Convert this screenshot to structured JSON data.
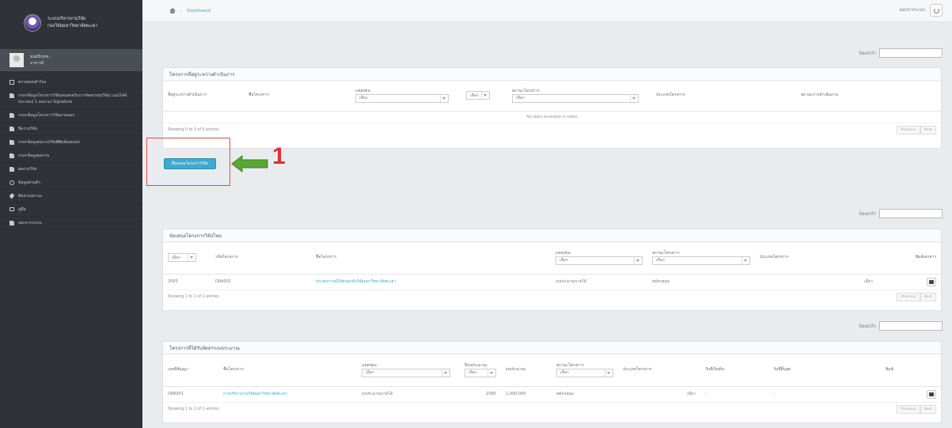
{
  "sidebar": {
    "brand_line1": "ระบบบริหารงานวิจัย",
    "brand_line2": "กองวิจัยมหาวิทยาลัยพะเยา",
    "user_name": "ชนม์นิรชช...",
    "user_role": "อาจารย์",
    "items": [
      {
        "icon": "calculator-icon",
        "label": "ตรวจสอบคำร้อง"
      },
      {
        "icon": "doc-icon",
        "label": "กรอกข้อมูลโครงการวิจัยเสนอขอรับการจัดสรรทุนวิจัย/ แนบไฟล์ประกอบ/ 1 ลงนาม/ Signature"
      },
      {
        "icon": "doc-icon",
        "label": "กรอกข้อมูลโครงการวิจัยภายนอก"
      },
      {
        "icon": "doc-icon",
        "label": "ปิดงานวิจัย"
      },
      {
        "icon": "doc-icon",
        "label": "กรอกข้อมูลผลงานวิจัยตีพิมพ์เผยแพร่"
      },
      {
        "icon": "doc-icon",
        "label": "กรอกข้อมูลผลงาน"
      },
      {
        "icon": "doc-icon",
        "label": "ผลงานวิจัย"
      },
      {
        "icon": "gear-icon",
        "label": "ข้อมูลส่วนตัว"
      },
      {
        "icon": "pin-icon",
        "label": "ติดตามสถานะ"
      },
      {
        "icon": "monitor-icon",
        "label": "คู่มือ"
      },
      {
        "icon": "doc-icon",
        "label": "ออกจากระบบ"
      }
    ]
  },
  "topbar": {
    "breadcrumb": "Dashboard",
    "right_text": "ออกจากระบบ"
  },
  "search_label": "Search:",
  "panel1": {
    "title": "โครงการที่อยู่ระหว่างดำเนินการ",
    "columns": [
      "ที่อยู่ระหว่างดำเนินการ",
      "ชื่อโครงการ",
      "แหล่งทุน",
      "",
      "สถานะโครงการ",
      "ประเภทโครงการ",
      "สถานะการดำเนินงาน"
    ],
    "empty_text": "No data available in table",
    "showing": "Showing 0 to 0 of 0 entries",
    "prev": "Previous",
    "next": "Next"
  },
  "add_button": "ยื่นเสนอโครงการวิจัย",
  "select_placeholder": "เลือก",
  "annotation": "1",
  "panel2": {
    "title": "ข้อเสนอโครงการวิจัยใหม่",
    "columns": [
      "",
      "รหัสโครงการ",
      "ชื่อโครงการ",
      "แหล่งทุน",
      "สถานะโครงการ",
      "ประเภทโครงการ",
      "พิมพ์เอกสาร"
    ],
    "rows": [
      {
        "year": "2565",
        "code": "DRA001",
        "name": "ประสบการณ์วิจัยของนักวิจัยมหาวิทยาลัยพะเยา",
        "fund": "งบประมาณรายได้",
        "status": "สมัครสมุด",
        "type": "เดี่ยว"
      }
    ],
    "showing": "Showing 1 to 1 of 1 entries",
    "prev": "Previous",
    "next": "Next"
  },
  "panel3": {
    "title": "โครงการที่ได้รับจัดสรรงบประมาณ",
    "columns": [
      "เลขที่สัญญา",
      "ชื่อโครงการ",
      "แหล่งทุน",
      "ปีงบประมาณ",
      "งบประมาณ",
      "สถานะโครงการ",
      "ประเภทโครงการ",
      "วันที่เริ่มต้น",
      "วันที่สิ้นสุด",
      "พิมพ์"
    ],
    "rows": [
      {
        "contract": "DRA001",
        "name": "การบริหารงานวิจัยมหาวิทยาลัยพะเยา",
        "fund": "งบประมาณรายได้",
        "year": "2565",
        "budget": "1,000,000",
        "status": "สมัครสมุด",
        "type": "เดี่ยว",
        "start": "-",
        "end": "-"
      }
    ],
    "showing": "Showing 1 to 1 of 1 entries",
    "prev": "Previous",
    "next": "Next"
  },
  "colors": {
    "sidebar_bg": "#2f3238",
    "accent": "#3fa9d0",
    "annotation_red": "#e23030",
    "arrow_green": "#5aa832"
  }
}
